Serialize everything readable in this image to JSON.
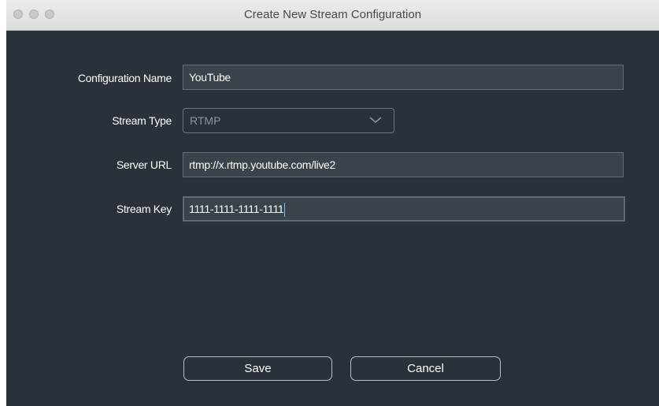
{
  "window": {
    "title": "Create New Stream Configuration"
  },
  "form": {
    "config_name_label": "Configuration Name",
    "config_name_value": "YouTube",
    "stream_type_label": "Stream Type",
    "stream_type_value": "RTMP",
    "server_url_label": "Server URL",
    "server_url_value": "rtmp://x.rtmp.youtube.com/live2",
    "stream_key_label": "Stream Key",
    "stream_key_value": "1111-1111-1111-1111"
  },
  "buttons": {
    "save_label": "Save",
    "cancel_label": "Cancel"
  },
  "icons": {
    "window_controls": [
      "close-icon",
      "minimize-icon",
      "zoom-icon"
    ],
    "dropdown": "chevron-down-icon"
  },
  "colors": {
    "background": "#2a3138",
    "field_background": "#3a4349",
    "caret": "#7fb7ff"
  }
}
